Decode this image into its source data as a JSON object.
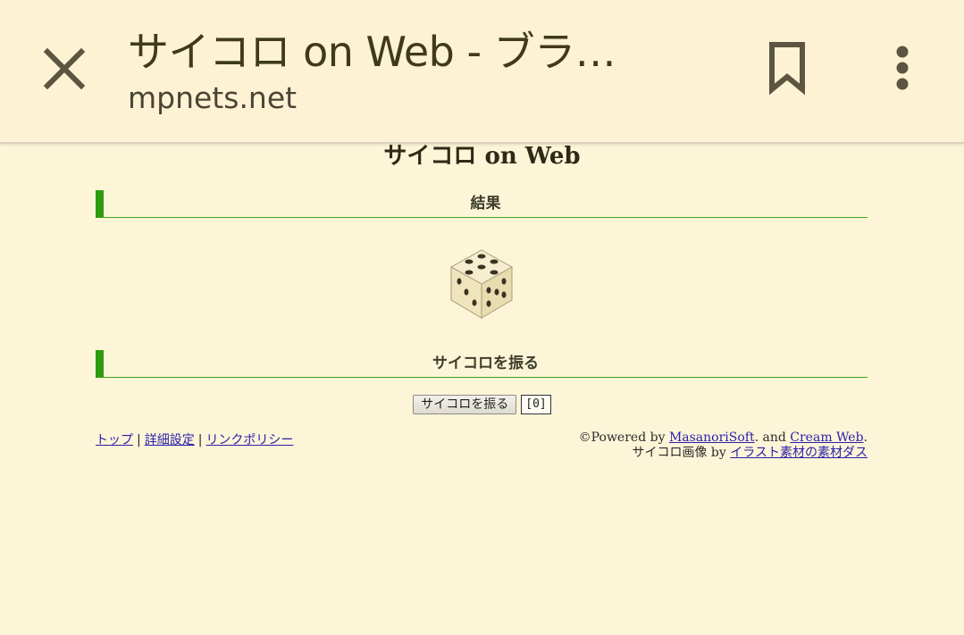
{
  "browser": {
    "title": "サイコロ on Web - ブラ…",
    "url": "mpnets.net",
    "icons": {
      "close": "close-icon",
      "bookmark": "bookmark-icon",
      "menu": "more-vert-icon"
    }
  },
  "page": {
    "title": "サイコロ on Web",
    "result_heading": "結果",
    "roll_heading": "サイコロを振る",
    "roll_button": "サイコロを振る",
    "roll_count": "[0]",
    "dice_face": "5",
    "nav": {
      "top": "トップ",
      "separator": "|",
      "settings": "詳細設定",
      "link_policy": "リンクポリシー"
    },
    "credits": {
      "powered_prefix": "©Powered by ",
      "masanori": "MasanoriSoft",
      "and": ". and ",
      "cream": "Cream Web",
      "period": ".",
      "image_prefix": "サイコロ画像 by ",
      "illust": "イラスト素材の素材ダス"
    }
  },
  "colors": {
    "background": "#fdf5d8",
    "accent_green": "#2e9b0c",
    "link": "#2a1fa8",
    "icon": "#5c5540"
  }
}
